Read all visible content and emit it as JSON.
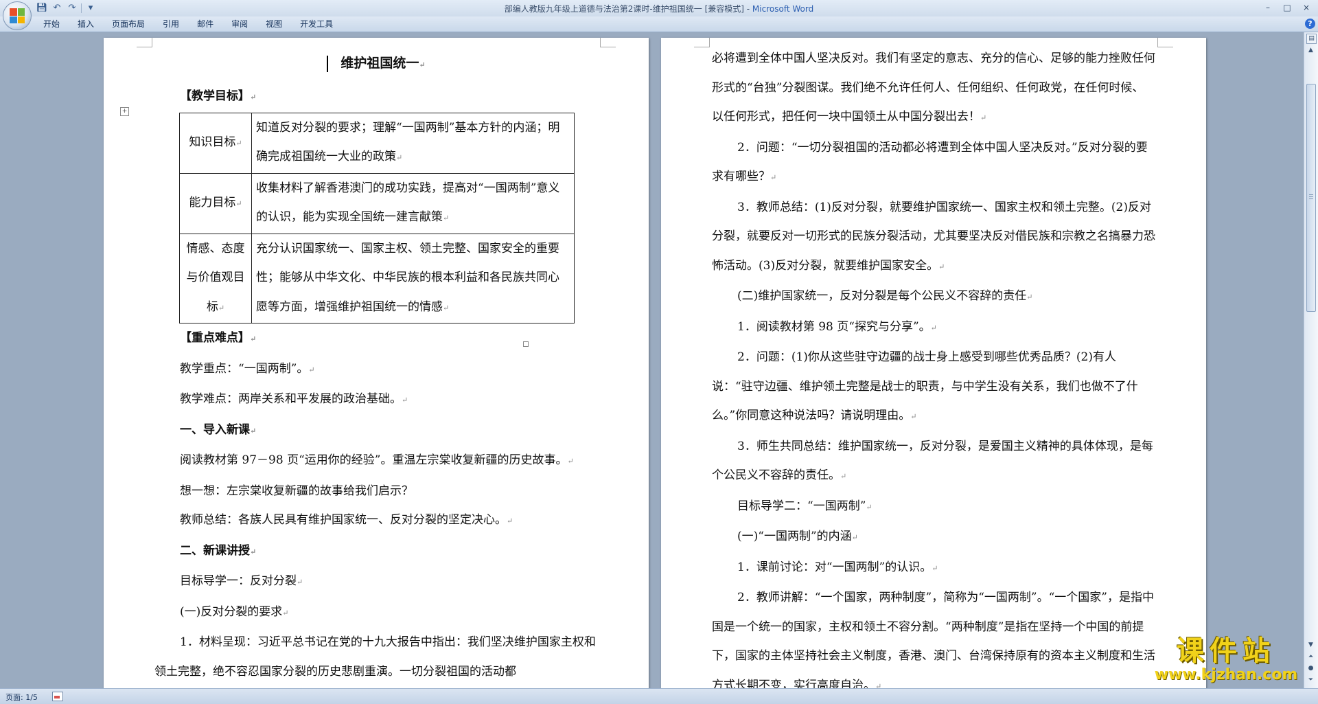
{
  "window": {
    "title": "部编人教版九年级上道德与法治第2课时-维护祖国统一 [兼容模式]",
    "title_separator": " - ",
    "app_name": "Microsoft Word",
    "controls": {
      "minimize": "–",
      "maximize": "□",
      "close": "×"
    }
  },
  "quick_access": {
    "save_icon": "floppy-icon",
    "undo_icon": "undo-icon",
    "redo_icon": "redo-icon",
    "customize_icon": "▾"
  },
  "ribbon": {
    "tabs": [
      "开始",
      "插入",
      "页面布局",
      "引用",
      "邮件",
      "审阅",
      "视图",
      "开发工具"
    ],
    "help": "?"
  },
  "page_left": {
    "title": "维护祖国统一",
    "sec_objectives": "【教学目标】",
    "objectives_table": [
      {
        "label": "知识目标",
        "text": "知道反对分裂的要求；理解“一国两制”基本方针的内涵；明确完成祖国统一大业的政策"
      },
      {
        "label": "能力目标",
        "text": "收集材料了解香港澳门的成功实践，提高对“一国两制”意义的认识，能为实现全国统一建言献策"
      },
      {
        "label": "情感、态度与价值观目标",
        "text": "充分认识国家统一、国家主权、领土完整、国家安全的重要性；能够从中华文化、中华民族的根本利益和各民族共同心愿等方面，增强维护祖国统一的情感"
      }
    ],
    "sec_key": "【重点难点】",
    "key_point": "教学重点：“一国两制”。",
    "difficult_point": "教学难点：两岸关系和平发展的政治基础。",
    "sec_intro": "一、导入新课",
    "intro_reading": "阅读教材第 97－98 页“运用你的经验”。重温左宗棠收复新疆的历史故事。",
    "intro_think": "想一想：左宗棠收复新疆的故事给我们启示？",
    "intro_summary": "教师总结：各族人民具有维护国家统一、反对分裂的坚定决心。",
    "sec_new": "二、新课讲授",
    "goal_1": "目标导学一：反对分裂",
    "goal_1_sub": "(一)反对分裂的要求",
    "material": "1．材料呈现：习近平总书记在党的十九大报告中指出：我们坚决维护国家主权和领土完整，绝不容忍国家分裂的历史悲剧重演。一切分裂祖国的活动都"
  },
  "page_right": {
    "p1": "必将遭到全体中国人坚决反对。我们有坚定的意志、充分的信心、足够的能力挫败任何形式的“台独”分裂图谋。我们绝不允许任何人、任何组织、任何政党，在任何时候、以任何形式，把任何一块中国领土从中国分裂出去！",
    "p2": "2．问题：“一切分裂祖国的活动都必将遭到全体中国人坚决反对。”反对分裂的要求有哪些？",
    "p3": "3．教师总结：(1)反对分裂，就要维护国家统一、国家主权和领土完整。(2)反对分裂，就要反对一切形式的民族分裂活动，尤其要坚决反对借民族和宗教之名搞暴力恐怖活动。(3)反对分裂，就要维护国家安全。",
    "p4": "(二)维护国家统一，反对分裂是每个公民义不容辞的责任",
    "p5": "1．阅读教材第 98 页“探究与分享”。",
    "p6": "2．问题：(1)你从这些驻守边疆的战士身上感受到哪些优秀品质？(2)有人说：“驻守边疆、维护领土完整是战士的职责，与中学生没有关系，我们也做不了什么。”你同意这种说法吗？请说明理由。",
    "p7": "3．师生共同总结：维护国家统一，反对分裂，是爱国主义精神的具体体现，是每个公民义不容辞的责任。",
    "p8": "目标导学二：“一国两制”",
    "p9": "(一)“一国两制”的内涵",
    "p10": "1．课前讨论：对“一国两制”的认识。",
    "p11": "2．教师讲解：“一个国家，两种制度”，简称为“一国两制”。“一个国家”，是指中国是一个统一的国家，主权和领土不容分割。“两种制度”是指在坚持一个中国的前提下，国家的主体坚持社会主义制度，香港、澳门、台湾保持原有的资本主义制度和生活方式长期不变，实行高度自治。"
  },
  "paragraph_mark": "↵",
  "status_bar": {
    "page_info": "页面: 1/5"
  },
  "watermark": {
    "name": "课件站",
    "url": "www.kjzhan.com"
  }
}
